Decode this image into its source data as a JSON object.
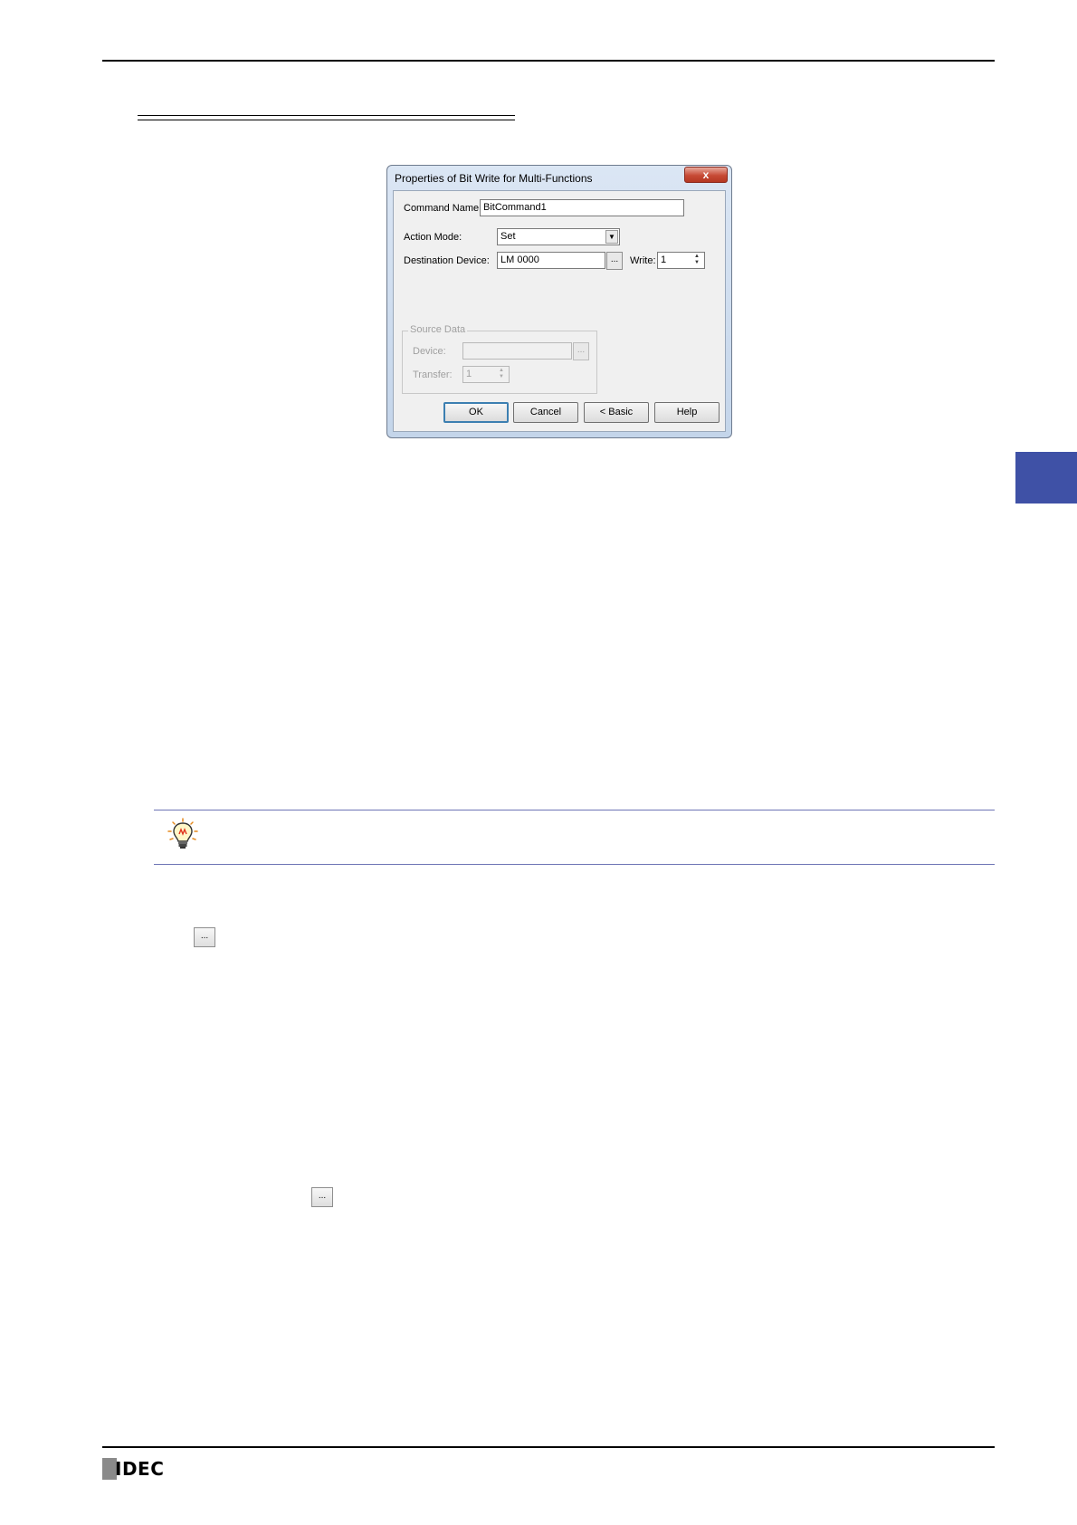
{
  "dialog": {
    "title": "Properties of Bit Write for Multi-Functions",
    "close_glyph": "x",
    "command_name_label": "Command Name:",
    "command_name_value": "BitCommand1",
    "action_mode_label": "Action Mode:",
    "action_mode_value": "Set",
    "destination_device_label": "Destination Device:",
    "destination_device_value": "LM 0000",
    "browse_glyph": "...",
    "write_label": "Write:",
    "write_value": "1",
    "source_data": {
      "legend": "Source Data",
      "device_label": "Device:",
      "device_value": "",
      "transfer_label": "Transfer:",
      "transfer_value": "1"
    },
    "buttons": {
      "ok": "OK",
      "cancel": "Cancel",
      "basic": "< Basic",
      "help": "Help"
    }
  },
  "inline_buttons": {
    "browse_1": "...",
    "browse_2": "..."
  },
  "footer": {
    "logo_text": "IDEC"
  },
  "colors": {
    "side_tab": "#3f51a6",
    "hint_rule": "#6d74b5"
  },
  "icons": [
    "lightbulb-hint-icon",
    "close-icon",
    "dropdown-arrow-icon",
    "spin-up-icon",
    "spin-down-icon"
  ]
}
